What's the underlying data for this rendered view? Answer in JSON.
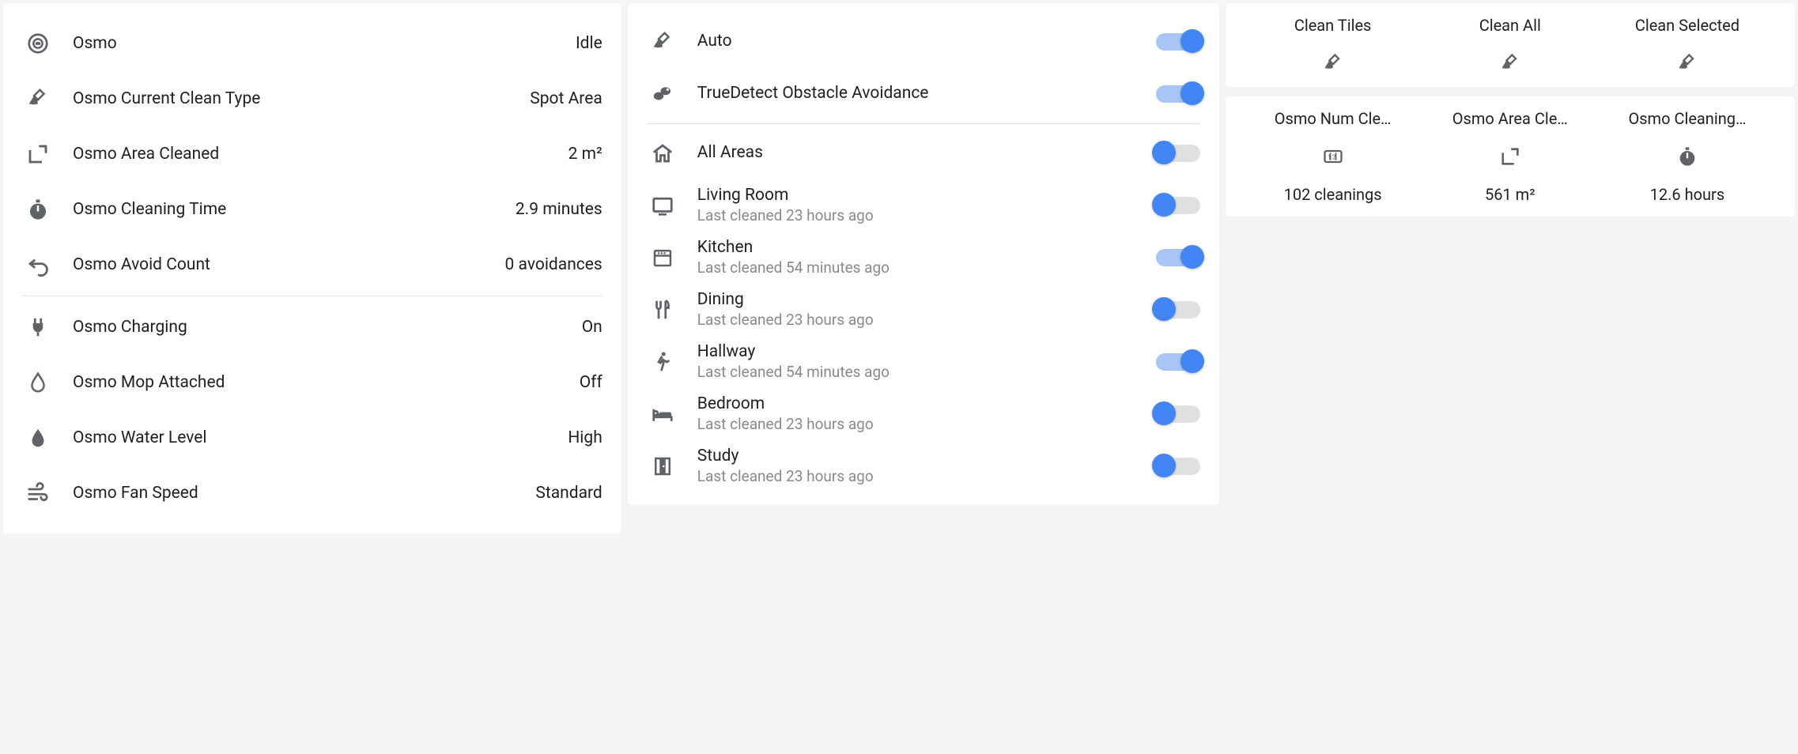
{
  "status": {
    "items": [
      {
        "icon": "robot",
        "label": "Osmo",
        "value": "Idle"
      },
      {
        "icon": "broom",
        "label": "Osmo Current Clean Type",
        "value": "Spot Area"
      },
      {
        "icon": "area",
        "label": "Osmo Area Cleaned",
        "value": "2 m²"
      },
      {
        "icon": "stopwatch",
        "label": "Osmo Cleaning Time",
        "value": "2.9 minutes"
      },
      {
        "icon": "undo",
        "label": "Osmo Avoid Count",
        "value": "0 avoidances"
      }
    ],
    "items2": [
      {
        "icon": "plug",
        "label": "Osmo Charging",
        "value": "On"
      },
      {
        "icon": "drop-outline",
        "label": "Osmo Mop Attached",
        "value": "Off"
      },
      {
        "icon": "drop",
        "label": "Osmo Water Level",
        "value": "High"
      },
      {
        "icon": "wind",
        "label": "Osmo Fan Speed",
        "value": "Standard"
      }
    ]
  },
  "toggles": {
    "top": [
      {
        "icon": "broom",
        "label": "Auto",
        "on": true,
        "knob": "right"
      },
      {
        "icon": "sensor",
        "label": "TrueDetect Obstacle Avoidance",
        "on": true,
        "knob": "right"
      }
    ],
    "areas": [
      {
        "icon": "home",
        "label": "All Areas",
        "sub": "",
        "on": true,
        "knob": "left"
      },
      {
        "icon": "tv",
        "label": "Living Room",
        "sub": "Last cleaned 23 hours ago",
        "on": true,
        "knob": "left"
      },
      {
        "icon": "oven",
        "label": "Kitchen",
        "sub": "Last cleaned 54 minutes ago",
        "on": true,
        "knob": "right"
      },
      {
        "icon": "fork",
        "label": "Dining",
        "sub": "Last cleaned 23 hours ago",
        "on": true,
        "knob": "left"
      },
      {
        "icon": "walk",
        "label": "Hallway",
        "sub": "Last cleaned 54 minutes ago",
        "on": true,
        "knob": "right"
      },
      {
        "icon": "bed",
        "label": "Bedroom",
        "sub": "Last cleaned 23 hours ago",
        "on": true,
        "knob": "left"
      },
      {
        "icon": "door",
        "label": "Study",
        "sub": "Last cleaned 23 hours ago",
        "on": true,
        "knob": "left"
      }
    ]
  },
  "actions": [
    {
      "label": "Clean Tiles",
      "icon": "broom"
    },
    {
      "label": "Clean All",
      "icon": "broom"
    },
    {
      "label": "Clean Selected",
      "icon": "broom"
    }
  ],
  "stats": [
    {
      "label": "Osmo Num Cle…",
      "icon": "counter",
      "value": "102 cleanings"
    },
    {
      "label": "Osmo Area Cle…",
      "icon": "area",
      "value": "561 m²"
    },
    {
      "label": "Osmo Cleaning…",
      "icon": "stopwatch",
      "value": "12.6 hours"
    }
  ]
}
